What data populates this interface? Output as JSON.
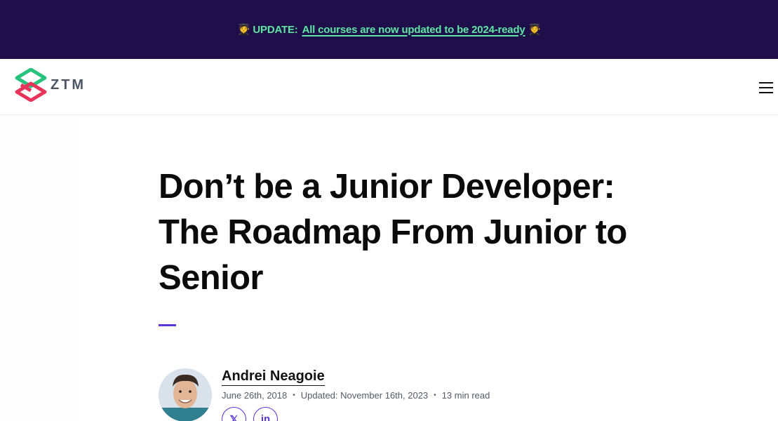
{
  "banner": {
    "prefix": "UPDATE:",
    "link_text": "All courses are now updated to be 2024-ready",
    "emoji_left": "🧑‍🎓",
    "emoji_right": "🧑‍🎓"
  },
  "header": {
    "logo_text": "ZTM",
    "menu_icon": "hamburger-menu-icon"
  },
  "article": {
    "title": "Don’t be a Junior Developer: The Roadmap From Junior to Senior",
    "author": "Andrei Neagoie",
    "published": "June 26th, 2018",
    "updated": "Updated: November 16th, 2023",
    "read_time": "13 min read",
    "separator": "•"
  },
  "social": {
    "x_label": "𝕏",
    "linkedin_label": "in"
  },
  "colors": {
    "banner_bg": "#1e0f4b",
    "banner_text": "#5ee6a2",
    "accent": "#5b34d6",
    "logo_green": "#28c27d",
    "logo_pink": "#e6345b"
  }
}
